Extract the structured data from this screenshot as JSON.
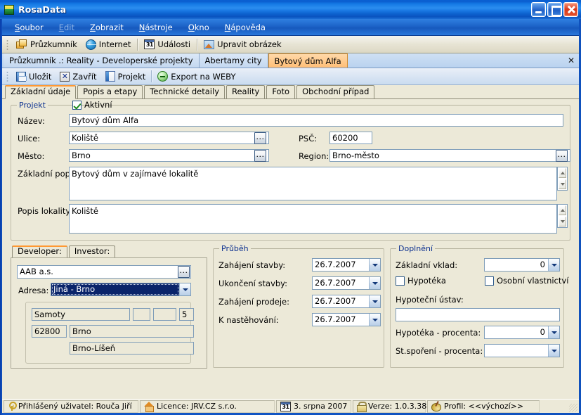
{
  "window": {
    "title": "RosaData",
    "icon": "app-icon",
    "buttons": {
      "minimize": "_",
      "maximize": "□",
      "close": "✕"
    }
  },
  "menu": {
    "items": [
      {
        "label": "Soubor",
        "accel": "S",
        "disabled": false
      },
      {
        "label": "Edit",
        "accel": "E",
        "disabled": true
      },
      {
        "label": "Zobrazit",
        "accel": "Z",
        "disabled": false
      },
      {
        "label": "Nástroje",
        "accel": "N",
        "disabled": false
      },
      {
        "label": "Okno",
        "accel": "O",
        "disabled": false
      },
      {
        "label": "Nápověda",
        "accel": "N",
        "disabled": false
      }
    ]
  },
  "main_toolbar": {
    "buttons": [
      {
        "label": "Průzkumník",
        "icon": "folder-icon"
      },
      {
        "label": "Internet",
        "icon": "globe-icon"
      },
      {
        "label": "Události",
        "icon": "calendar-icon",
        "icon_text": "31"
      },
      {
        "label": "Upravit obrázek",
        "icon": "picture-icon"
      }
    ]
  },
  "document_tabs": {
    "tabs": [
      {
        "label": "Průzkumník .: Reality - Developerské projekty",
        "active": false
      },
      {
        "label": "Abertamy city",
        "active": false
      },
      {
        "label": "Bytový dům Alfa",
        "active": true
      }
    ],
    "close_label": "✕"
  },
  "form_toolbar": {
    "buttons": [
      {
        "label": "Uložit",
        "icon": "save-icon"
      },
      {
        "label": "Zavřít",
        "icon": "close-x-icon",
        "icon_text": "✕"
      },
      {
        "label": "Projekt",
        "icon": "project-icon"
      },
      {
        "label": "Export na WEBY",
        "icon": "export-arrow-icon"
      }
    ]
  },
  "sub_tabs": {
    "tabs": [
      {
        "label": "Základní údaje",
        "active": true
      },
      {
        "label": "Popis a etapy",
        "active": false
      },
      {
        "label": "Technické detaily",
        "active": false
      },
      {
        "label": "Reality",
        "active": false
      },
      {
        "label": "Foto",
        "active": false
      },
      {
        "label": "Obchodní případ",
        "active": false
      }
    ]
  },
  "project_group": {
    "legend": "Projekt",
    "active_checkbox": {
      "label": "Aktivní",
      "checked": true
    },
    "fields": {
      "nazev_label": "Název:",
      "nazev_value": "Bytový dům Alfa",
      "ulice_label": "Ulice:",
      "ulice_value": "Koliště",
      "mesto_label": "Město:",
      "mesto_value": "Brno",
      "psc_label": "PSČ:",
      "psc_value": "60200",
      "region_label": "Region:",
      "region_value": "Brno-město",
      "zakladni_popis_label": "Základní popis:",
      "zakladni_popis_value": "Bytový dům v zajímavé lokalitě",
      "popis_lokality_label": "Popis lokality:",
      "popis_lokality_value": "Koliště"
    },
    "browse_button": "..."
  },
  "developer_group": {
    "tabs": [
      {
        "label": "Developer:",
        "active": true
      },
      {
        "label": "Investor:",
        "active": false
      }
    ],
    "company_value": "AAB a.s.",
    "browse_button": "...",
    "adresa_label": "Adresa:",
    "adresa_value": "Jiná - Brno",
    "address_fields": {
      "street": "Samoty",
      "extra1": "",
      "extra2": "",
      "number": "5",
      "zip": "62800",
      "city": "Brno",
      "district": "Brno-Líšeň"
    }
  },
  "progress_group": {
    "legend": "Průběh",
    "rows": [
      {
        "label": "Zahájení stavby:",
        "value": "26.7.2007"
      },
      {
        "label": "Ukončení stavby:",
        "value": "26.7.2007"
      },
      {
        "label": "Zahájení prodeje:",
        "value": "26.7.2007"
      },
      {
        "label": "K nastěhování:",
        "value": "26.7.2007"
      }
    ]
  },
  "supplement_group": {
    "legend": "Doplnění",
    "zakladni_vklad_label": "Základní vklad:",
    "zakladni_vklad_value": "0",
    "hypoteka_checkbox": {
      "label": "Hypotéka",
      "checked": false
    },
    "osobni_vlastnictvi_checkbox": {
      "label": "Osobní vlastnictví",
      "checked": false
    },
    "hypotecni_ustav_label": "Hypoteční ústav:",
    "hypotecni_ustav_value": "",
    "hypoteka_procenta_label": "Hypotéka - procenta:",
    "hypoteka_procenta_value": "0",
    "st_sporeni_label": "St.spoření - procenta:",
    "st_sporeni_value": ""
  },
  "status_bar": {
    "panels": [
      {
        "icon": "key-icon",
        "text": "Přihlášený uživatel: Rouča Jiří"
      },
      {
        "icon": "house-icon",
        "text": "Licence: JRV.CZ s.r.o."
      },
      {
        "icon": "calendar-icon",
        "icon_text": "31",
        "text": "3. srpna 2007"
      },
      {
        "icon": "lock-icon",
        "text": "Verze: 1.0.3.38"
      },
      {
        "icon": "palette-icon",
        "text": "Profil: <<výchozí>>"
      }
    ]
  },
  "colors": {
    "window_frame_blue": "#0f51bd",
    "titlebar_blue": "#2b8ef0",
    "form_background": "#ece9d8",
    "active_tab_orange": "#ffbe76",
    "tab_accent_orange": "#ff9933",
    "group_label_blue": "#0a2f8f",
    "selection_blue": "#0a246a",
    "field_border": "#7f9db9",
    "close_button_red": "#d83a1b"
  }
}
